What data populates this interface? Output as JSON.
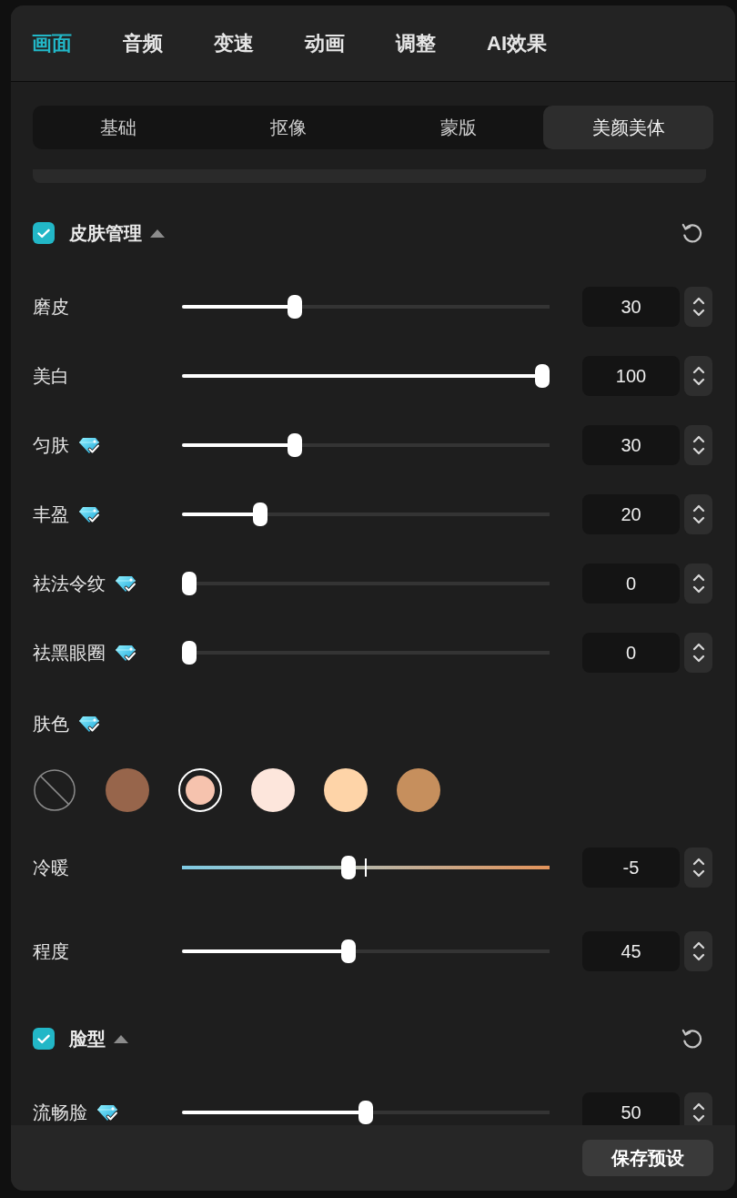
{
  "top_tabs": [
    {
      "label": "画面",
      "selected": true
    },
    {
      "label": "音频",
      "selected": false
    },
    {
      "label": "变速",
      "selected": false
    },
    {
      "label": "动画",
      "selected": false
    },
    {
      "label": "调整",
      "selected": false
    },
    {
      "label": "AI效果",
      "selected": false
    }
  ],
  "sub_tabs": [
    {
      "label": "基础",
      "selected": false
    },
    {
      "label": "抠像",
      "selected": false
    },
    {
      "label": "蒙版",
      "selected": false
    },
    {
      "label": "美颜美体",
      "selected": true
    }
  ],
  "sections": [
    {
      "title": "皮肤管理",
      "checked": true,
      "expanded": true,
      "rows": [
        {
          "kind": "slider",
          "label": "磨皮",
          "premium": false,
          "level": 0.3,
          "value": "30"
        },
        {
          "kind": "slider",
          "label": "美白",
          "premium": false,
          "level": 1,
          "value": "100"
        },
        {
          "kind": "slider",
          "label": "匀肤",
          "premium": true,
          "level": 0.3,
          "value": "30"
        },
        {
          "kind": "slider",
          "label": "丰盈",
          "premium": true,
          "level": 0.2,
          "value": "20"
        },
        {
          "kind": "slider",
          "label": "祛法令纹",
          "premium": true,
          "level": 0,
          "value": "0"
        },
        {
          "kind": "slider",
          "label": "祛黑眼圈",
          "premium": true,
          "level": 0,
          "value": "0"
        },
        {
          "kind": "swatches",
          "label": "肤色",
          "premium": true,
          "swatches": [
            {
              "kind": "none",
              "selected": false
            },
            {
              "kind": "tone",
              "color": "#97654b",
              "selected": false
            },
            {
              "kind": "tone",
              "color": "#f6c3ae",
              "selected": true
            },
            {
              "kind": "tone",
              "color": "#fde6dc",
              "selected": false
            },
            {
              "kind": "tone",
              "color": "#fed4a8",
              "selected": false
            },
            {
              "kind": "tone",
              "color": "#c68f5d",
              "selected": false
            }
          ]
        },
        {
          "kind": "gradient_slider",
          "label": "冷暖",
          "premium": false,
          "level": 0.45,
          "value": "-5"
        },
        {
          "kind": "slider",
          "label": "程度",
          "premium": false,
          "level": 0.45,
          "value": "45"
        }
      ]
    },
    {
      "title": "脸型",
      "checked": true,
      "expanded": true,
      "rows": [
        {
          "kind": "slider",
          "label": "流畅脸",
          "premium": true,
          "level": 0.5,
          "value": "50"
        }
      ]
    }
  ],
  "footer": {
    "save_button": "保存预设"
  }
}
